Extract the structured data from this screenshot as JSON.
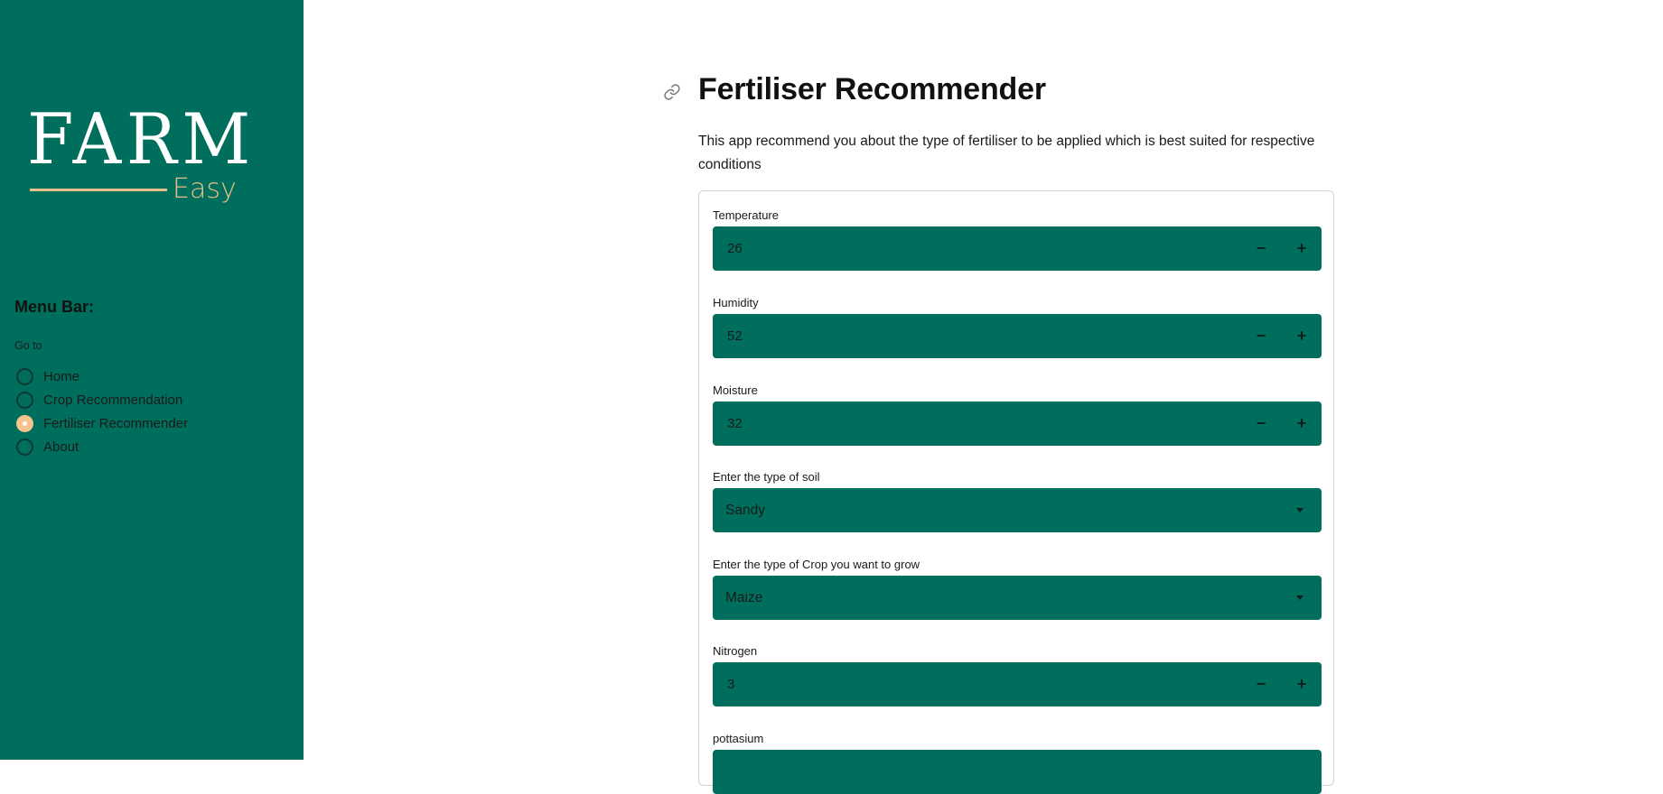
{
  "sidebar": {
    "logo": {
      "main": "FARM",
      "sub": "Easy"
    },
    "menu_title": "Menu Bar:",
    "goto_label": "Go to",
    "items": [
      {
        "label": "Home",
        "selected": false
      },
      {
        "label": "Crop Recommendation",
        "selected": false
      },
      {
        "label": "Fertiliser Recommender",
        "selected": true
      },
      {
        "label": "About",
        "selected": false
      }
    ]
  },
  "main": {
    "title": "Fertiliser Recommender",
    "description": "This app recommend you about the type of fertiliser to be applied which is best suited for respective conditions",
    "fields": {
      "temperature": {
        "label": "Temperature",
        "value": "26"
      },
      "humidity": {
        "label": "Humidity",
        "value": "52"
      },
      "moisture": {
        "label": "Moisture",
        "value": "32"
      },
      "soil": {
        "label": "Enter the type of soil",
        "value": "Sandy"
      },
      "crop": {
        "label": "Enter the type of Crop you want to grow",
        "value": "Maize"
      },
      "nitrogen": {
        "label": "Nitrogen",
        "value": "3"
      },
      "potassium": {
        "label": "pottasium",
        "value": ""
      }
    },
    "stepper": {
      "minus": "−",
      "plus": "+"
    }
  },
  "colors": {
    "sidebar_bg": "#006e5c",
    "accent": "#e7bf89",
    "radio_selected": "#f6c48d",
    "control_bg": "#006e5c"
  },
  "icons": [
    "link-icon",
    "chevron-down-icon",
    "minus-icon",
    "plus-icon"
  ]
}
